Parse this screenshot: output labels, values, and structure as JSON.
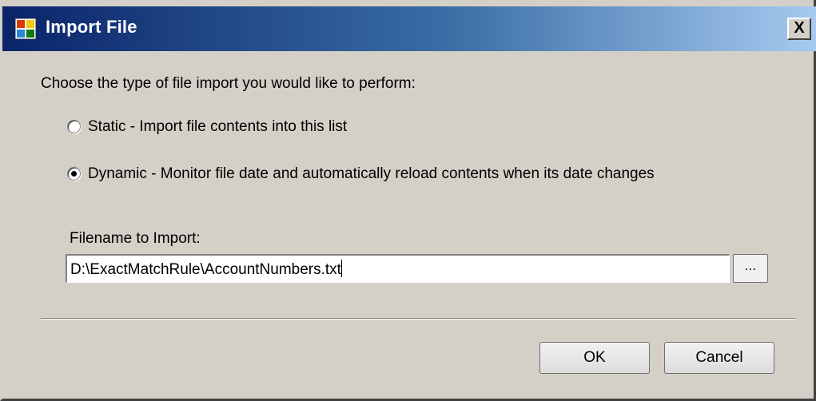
{
  "window": {
    "title": "Import File",
    "close_label": "X"
  },
  "dialog": {
    "prompt": "Choose the type of file import you would like to perform:",
    "options": [
      {
        "label": "Static - Import file contents into this list",
        "selected": false
      },
      {
        "label": "Dynamic - Monitor file date and automatically reload contents when its date changes",
        "selected": true
      }
    ],
    "filename_label": "Filename to Import:",
    "filename_value": "D:\\ExactMatchRule\\AccountNumbers.txt",
    "browse_label": "...",
    "ok_label": "OK",
    "cancel_label": "Cancel"
  },
  "colors": {
    "title_gradient_start": "#0a246a",
    "title_gradient_end": "#a6caf0",
    "dialog_background": "#d4d0c8"
  }
}
